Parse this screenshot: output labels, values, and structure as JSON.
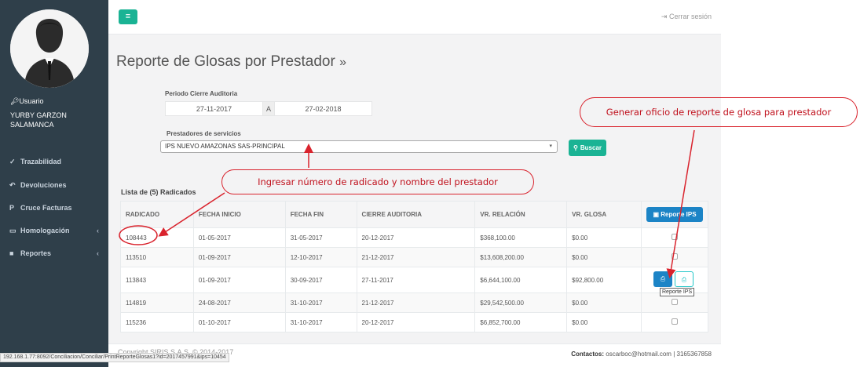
{
  "sidebar": {
    "user_label": "Usuario",
    "user_name": "YURBY GARZON SALAMANCA",
    "items": [
      {
        "label": "Trazabilidad",
        "icon": "thumbs-up-icon"
      },
      {
        "label": "Devoluciones",
        "icon": "reply-icon"
      },
      {
        "label": "Cruce Facturas",
        "icon": "paypal-icon"
      },
      {
        "label": "Homologación",
        "icon": "desktop-icon"
      },
      {
        "label": "Reportes",
        "icon": "file-icon"
      }
    ]
  },
  "topbar": {
    "logout_label": "Cerrar sesión"
  },
  "page": {
    "title": "Reporte de Glosas por Prestador",
    "title_suffix": "»"
  },
  "filters": {
    "periodo_label": "Periodo Cierre Auditoria",
    "fecha_desde": "27-11-2017",
    "separator": "A",
    "fecha_hasta": "27-02-2018",
    "prestadores_label": "Prestadores de servicios",
    "prestador_selected": "IPS NUEVO AMAZONAS SAS-PRINCIPAL",
    "buscar_label": "Buscar"
  },
  "list": {
    "title": "Lista de (5) Radicados",
    "headers": [
      "RADICADO",
      "FECHA INICIO",
      "FECHA FIN",
      "CIERRE AUDITORIA",
      "VR. RELACIÓN",
      "VR. GLOSA"
    ],
    "report_button_label": "Reporte IPS",
    "rows": [
      {
        "radicado": "108443",
        "fecha_inicio": "01-05-2017",
        "fecha_fin": "31-05-2017",
        "cierre": "20-12-2017",
        "vr_relacion": "$368,100.00",
        "vr_glosa": "$0.00"
      },
      {
        "radicado": "113510",
        "fecha_inicio": "01-09-2017",
        "fecha_fin": "12-10-2017",
        "cierre": "21-12-2017",
        "vr_relacion": "$13,608,200.00",
        "vr_glosa": "$0.00"
      },
      {
        "radicado": "113843",
        "fecha_inicio": "01-09-2017",
        "fecha_fin": "30-09-2017",
        "cierre": "27-11-2017",
        "vr_relacion": "$6,644,100.00",
        "vr_glosa": "$92,800.00"
      },
      {
        "radicado": "114819",
        "fecha_inicio": "24-08-2017",
        "fecha_fin": "31-10-2017",
        "cierre": "21-12-2017",
        "vr_relacion": "$29,542,500.00",
        "vr_glosa": "$0.00"
      },
      {
        "radicado": "115236",
        "fecha_inicio": "01-10-2017",
        "fecha_fin": "31-10-2017",
        "cierre": "20-12-2017",
        "vr_relacion": "$6,852,700.00",
        "vr_glosa": "$0.00"
      }
    ],
    "tooltip": "Reporte IPS"
  },
  "footer": {
    "copyright": "Copyright SIRIS S.A.S. © 2014-2017",
    "contactos_label": "Contactos:",
    "contactos_value": "oscarboc@hotmail.com | 3165367858"
  },
  "statusbar": {
    "url": "192.168.1.77:8092/Conciliacion/Conciliar/PrintReporteGlosas1?id=2017457991&ips=10454"
  },
  "annotations": {
    "callout_prestador": "Ingresar número de radicado y nombre del prestador",
    "callout_oficio": "Generar oficio de reporte de glosa para prestador",
    "color": "#d9232d"
  }
}
